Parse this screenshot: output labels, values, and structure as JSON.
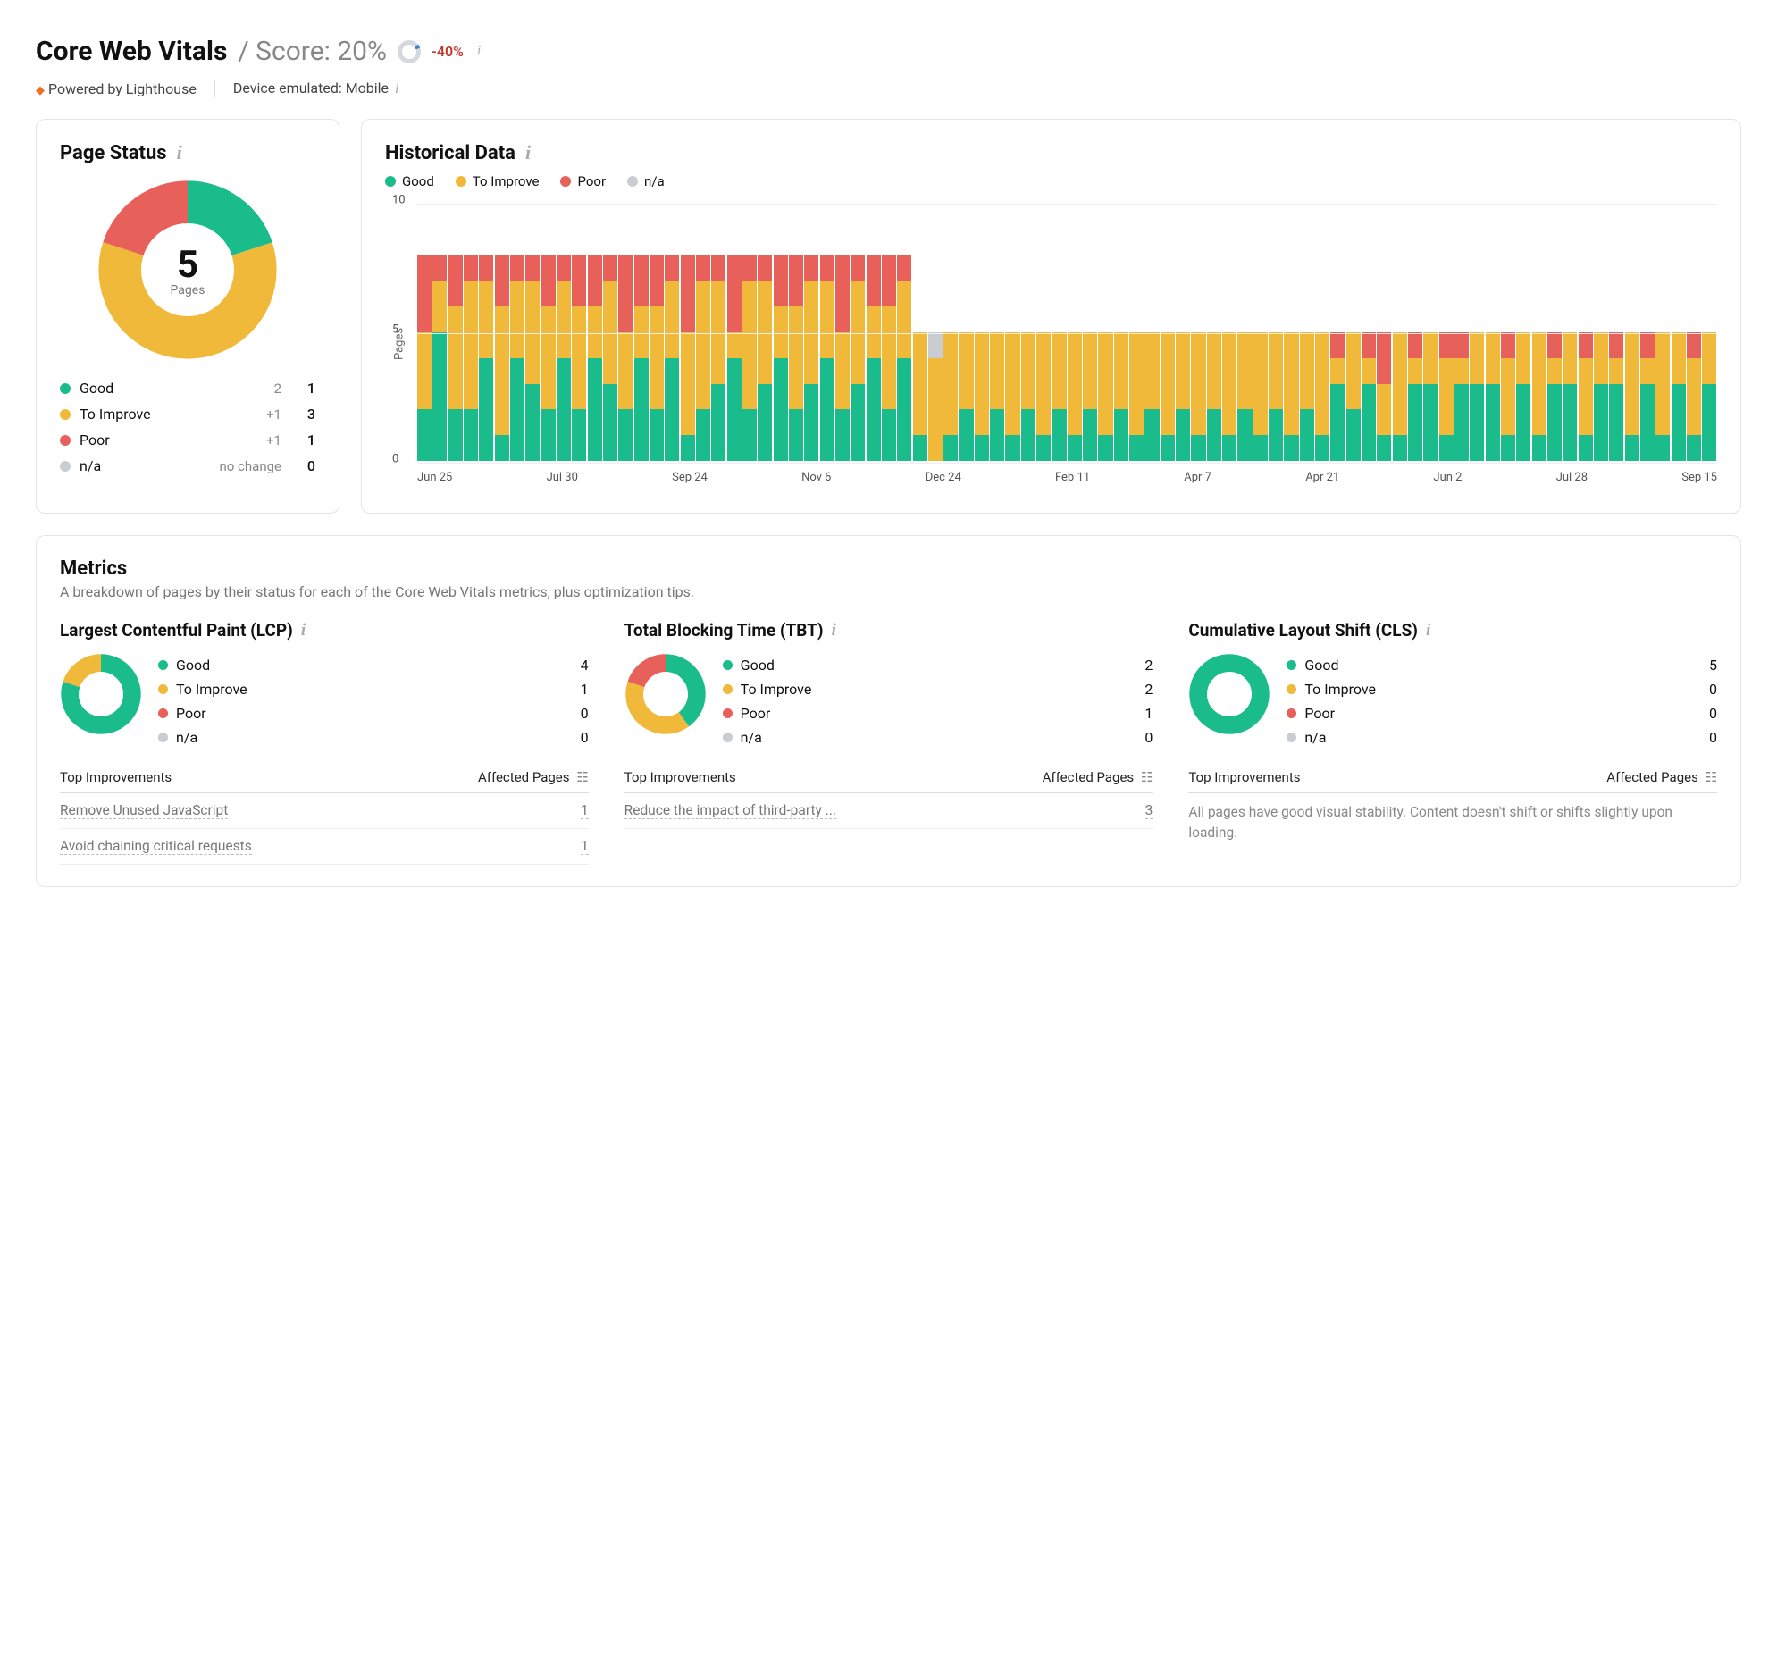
{
  "colors": {
    "good": "#1abc8c",
    "improve": "#f0b93a",
    "poor": "#e7605a",
    "na": "#c9cdd1"
  },
  "header": {
    "title": "Core Web Vitals",
    "score_label": "/ Score: 20%",
    "delta": "-40%"
  },
  "subline": {
    "powered": "Powered by Lighthouse",
    "device": "Device emulated: Mobile"
  },
  "page_status": {
    "title": "Page Status",
    "total_pages": "5",
    "pages_label": "Pages",
    "rows": [
      {
        "key": "good",
        "label": "Good",
        "delta": "-2",
        "value": 1
      },
      {
        "key": "improve",
        "label": "To Improve",
        "delta": "+1",
        "value": 3
      },
      {
        "key": "poor",
        "label": "Poor",
        "delta": "+1",
        "value": 1
      },
      {
        "key": "na",
        "label": "n/a",
        "delta": "no change",
        "value": 0
      }
    ]
  },
  "historical": {
    "title": "Historical Data",
    "legend": [
      {
        "key": "good",
        "label": "Good"
      },
      {
        "key": "improve",
        "label": "To Improve"
      },
      {
        "key": "poor",
        "label": "Poor"
      },
      {
        "key": "na",
        "label": "n/a"
      }
    ],
    "y_label": "Pages",
    "y_ticks": [
      0,
      5,
      10
    ],
    "x_ticks": [
      "Jun 25",
      "Jul 30",
      "Sep 24",
      "Nov 6",
      "Dec 24",
      "Feb 11",
      "Apr 7",
      "Apr 21",
      "Jun 2",
      "Jul 28",
      "Sep 15"
    ]
  },
  "chart_data": {
    "historical": {
      "type": "bar",
      "stacked": true,
      "ylabel": "Pages",
      "xlabel": "",
      "ylim": [
        0,
        10
      ],
      "x_ticks_visible": [
        "Jun 25",
        "Jul 30",
        "Sep 24",
        "Nov 6",
        "Dec 24",
        "Feb 11",
        "Apr 7",
        "Apr 21",
        "Jun 2",
        "Jul 28",
        "Sep 15"
      ],
      "series_order": [
        "good",
        "improve",
        "poor",
        "na"
      ],
      "points": [
        {
          "g": 2,
          "i": 3,
          "p": 3,
          "n": 0
        },
        {
          "g": 5,
          "i": 2,
          "p": 1,
          "n": 0
        },
        {
          "g": 2,
          "i": 4,
          "p": 2,
          "n": 0
        },
        {
          "g": 2,
          "i": 5,
          "p": 1,
          "n": 0
        },
        {
          "g": 4,
          "i": 3,
          "p": 1,
          "n": 0
        },
        {
          "g": 1,
          "i": 5,
          "p": 2,
          "n": 0
        },
        {
          "g": 4,
          "i": 3,
          "p": 1,
          "n": 0
        },
        {
          "g": 3,
          "i": 4,
          "p": 1,
          "n": 0
        },
        {
          "g": 2,
          "i": 4,
          "p": 2,
          "n": 0
        },
        {
          "g": 4,
          "i": 3,
          "p": 1,
          "n": 0
        },
        {
          "g": 2,
          "i": 4,
          "p": 2,
          "n": 0
        },
        {
          "g": 4,
          "i": 2,
          "p": 2,
          "n": 0
        },
        {
          "g": 3,
          "i": 4,
          "p": 1,
          "n": 0
        },
        {
          "g": 2,
          "i": 3,
          "p": 3,
          "n": 0
        },
        {
          "g": 4,
          "i": 2,
          "p": 2,
          "n": 0
        },
        {
          "g": 2,
          "i": 4,
          "p": 2,
          "n": 0
        },
        {
          "g": 4,
          "i": 3,
          "p": 1,
          "n": 0
        },
        {
          "g": 1,
          "i": 4,
          "p": 3,
          "n": 0
        },
        {
          "g": 2,
          "i": 5,
          "p": 1,
          "n": 0
        },
        {
          "g": 3,
          "i": 4,
          "p": 1,
          "n": 0
        },
        {
          "g": 4,
          "i": 1,
          "p": 3,
          "n": 0
        },
        {
          "g": 2,
          "i": 5,
          "p": 1,
          "n": 0
        },
        {
          "g": 3,
          "i": 4,
          "p": 1,
          "n": 0
        },
        {
          "g": 4,
          "i": 2,
          "p": 2,
          "n": 0
        },
        {
          "g": 2,
          "i": 4,
          "p": 2,
          "n": 0
        },
        {
          "g": 3,
          "i": 4,
          "p": 1,
          "n": 0
        },
        {
          "g": 4,
          "i": 3,
          "p": 1,
          "n": 0
        },
        {
          "g": 2,
          "i": 3,
          "p": 3,
          "n": 0
        },
        {
          "g": 3,
          "i": 4,
          "p": 1,
          "n": 0
        },
        {
          "g": 4,
          "i": 2,
          "p": 2,
          "n": 0
        },
        {
          "g": 2,
          "i": 4,
          "p": 2,
          "n": 0
        },
        {
          "g": 4,
          "i": 3,
          "p": 1,
          "n": 0
        },
        {
          "g": 1,
          "i": 4,
          "p": 0,
          "n": 0
        },
        {
          "g": 0,
          "i": 4,
          "p": 0,
          "n": 1
        },
        {
          "g": 1,
          "i": 4,
          "p": 0,
          "n": 0
        },
        {
          "g": 2,
          "i": 3,
          "p": 0,
          "n": 0
        },
        {
          "g": 1,
          "i": 4,
          "p": 0,
          "n": 0
        },
        {
          "g": 2,
          "i": 3,
          "p": 0,
          "n": 0
        },
        {
          "g": 1,
          "i": 4,
          "p": 0,
          "n": 0
        },
        {
          "g": 2,
          "i": 3,
          "p": 0,
          "n": 0
        },
        {
          "g": 1,
          "i": 4,
          "p": 0,
          "n": 0
        },
        {
          "g": 2,
          "i": 3,
          "p": 0,
          "n": 0
        },
        {
          "g": 1,
          "i": 4,
          "p": 0,
          "n": 0
        },
        {
          "g": 2,
          "i": 3,
          "p": 0,
          "n": 0
        },
        {
          "g": 1,
          "i": 4,
          "p": 0,
          "n": 0
        },
        {
          "g": 2,
          "i": 3,
          "p": 0,
          "n": 0
        },
        {
          "g": 1,
          "i": 4,
          "p": 0,
          "n": 0
        },
        {
          "g": 2,
          "i": 3,
          "p": 0,
          "n": 0
        },
        {
          "g": 1,
          "i": 4,
          "p": 0,
          "n": 0
        },
        {
          "g": 2,
          "i": 3,
          "p": 0,
          "n": 0
        },
        {
          "g": 1,
          "i": 4,
          "p": 0,
          "n": 0
        },
        {
          "g": 2,
          "i": 3,
          "p": 0,
          "n": 0
        },
        {
          "g": 1,
          "i": 4,
          "p": 0,
          "n": 0
        },
        {
          "g": 2,
          "i": 3,
          "p": 0,
          "n": 0
        },
        {
          "g": 1,
          "i": 4,
          "p": 0,
          "n": 0
        },
        {
          "g": 2,
          "i": 3,
          "p": 0,
          "n": 0
        },
        {
          "g": 1,
          "i": 4,
          "p": 0,
          "n": 0
        },
        {
          "g": 2,
          "i": 3,
          "p": 0,
          "n": 0
        },
        {
          "g": 1,
          "i": 4,
          "p": 0,
          "n": 0
        },
        {
          "g": 3,
          "i": 1,
          "p": 1,
          "n": 0
        },
        {
          "g": 2,
          "i": 3,
          "p": 0,
          "n": 0
        },
        {
          "g": 3,
          "i": 1,
          "p": 1,
          "n": 0
        },
        {
          "g": 1,
          "i": 2,
          "p": 2,
          "n": 0
        },
        {
          "g": 1,
          "i": 4,
          "p": 0,
          "n": 0
        },
        {
          "g": 3,
          "i": 1,
          "p": 1,
          "n": 0
        },
        {
          "g": 3,
          "i": 2,
          "p": 0,
          "n": 0
        },
        {
          "g": 1,
          "i": 3,
          "p": 1,
          "n": 0
        },
        {
          "g": 3,
          "i": 1,
          "p": 1,
          "n": 0
        },
        {
          "g": 3,
          "i": 2,
          "p": 0,
          "n": 0
        },
        {
          "g": 3,
          "i": 2,
          "p": 0,
          "n": 0
        },
        {
          "g": 1,
          "i": 3,
          "p": 1,
          "n": 0
        },
        {
          "g": 3,
          "i": 2,
          "p": 0,
          "n": 0
        },
        {
          "g": 1,
          "i": 4,
          "p": 0,
          "n": 0
        },
        {
          "g": 3,
          "i": 1,
          "p": 1,
          "n": 0
        },
        {
          "g": 3,
          "i": 2,
          "p": 0,
          "n": 0
        },
        {
          "g": 1,
          "i": 3,
          "p": 1,
          "n": 0
        },
        {
          "g": 3,
          "i": 2,
          "p": 0,
          "n": 0
        },
        {
          "g": 3,
          "i": 1,
          "p": 1,
          "n": 0
        },
        {
          "g": 1,
          "i": 4,
          "p": 0,
          "n": 0
        },
        {
          "g": 3,
          "i": 1,
          "p": 1,
          "n": 0
        },
        {
          "g": 1,
          "i": 4,
          "p": 0,
          "n": 0
        },
        {
          "g": 3,
          "i": 2,
          "p": 0,
          "n": 0
        },
        {
          "g": 1,
          "i": 3,
          "p": 1,
          "n": 0
        },
        {
          "g": 3,
          "i": 2,
          "p": 0,
          "n": 0
        }
      ]
    },
    "page_status_donut": {
      "type": "pie",
      "data": {
        "Good": 1,
        "To Improve": 3,
        "Poor": 1,
        "n/a": 0
      }
    },
    "lcp_donut": {
      "type": "pie",
      "data": {
        "Good": 4,
        "To Improve": 1,
        "Poor": 0,
        "n/a": 0
      }
    },
    "tbt_donut": {
      "type": "pie",
      "data": {
        "Good": 2,
        "To Improve": 2,
        "Poor": 1,
        "n/a": 0
      }
    },
    "cls_donut": {
      "type": "pie",
      "data": {
        "Good": 5,
        "To Improve": 0,
        "Poor": 0,
        "n/a": 0
      }
    }
  },
  "metrics": {
    "title": "Metrics",
    "subtitle": "A breakdown of pages by their status for each of the Core Web Vitals metrics, plus optimization tips.",
    "improvements_header": "Top Improvements",
    "affected_header": "Affected Pages",
    "cols": [
      {
        "id": "lcp",
        "title": "Largest Contentful Paint (LCP)",
        "rows": [
          {
            "key": "good",
            "label": "Good",
            "value": 4
          },
          {
            "key": "improve",
            "label": "To Improve",
            "value": 1
          },
          {
            "key": "poor",
            "label": "Poor",
            "value": 0
          },
          {
            "key": "na",
            "label": "n/a",
            "value": 0
          }
        ],
        "improvements": [
          {
            "name": "Remove Unused JavaScript",
            "pages": 1
          },
          {
            "name": "Avoid chaining critical requests",
            "pages": 1
          }
        ]
      },
      {
        "id": "tbt",
        "title": "Total Blocking Time (TBT)",
        "rows": [
          {
            "key": "good",
            "label": "Good",
            "value": 2
          },
          {
            "key": "improve",
            "label": "To Improve",
            "value": 2
          },
          {
            "key": "poor",
            "label": "Poor",
            "value": 1
          },
          {
            "key": "na",
            "label": "n/a",
            "value": 0
          }
        ],
        "improvements": [
          {
            "name": "Reduce the impact of third-party ...",
            "pages": 3
          }
        ]
      },
      {
        "id": "cls",
        "title": "Cumulative Layout Shift (CLS)",
        "rows": [
          {
            "key": "good",
            "label": "Good",
            "value": 5
          },
          {
            "key": "improve",
            "label": "To Improve",
            "value": 0
          },
          {
            "key": "poor",
            "label": "Poor",
            "value": 0
          },
          {
            "key": "na",
            "label": "n/a",
            "value": 0
          }
        ],
        "improvements": [],
        "empty_text": "All pages have good visual stability. Content doesn't shift or shifts slightly upon loading."
      }
    ]
  }
}
